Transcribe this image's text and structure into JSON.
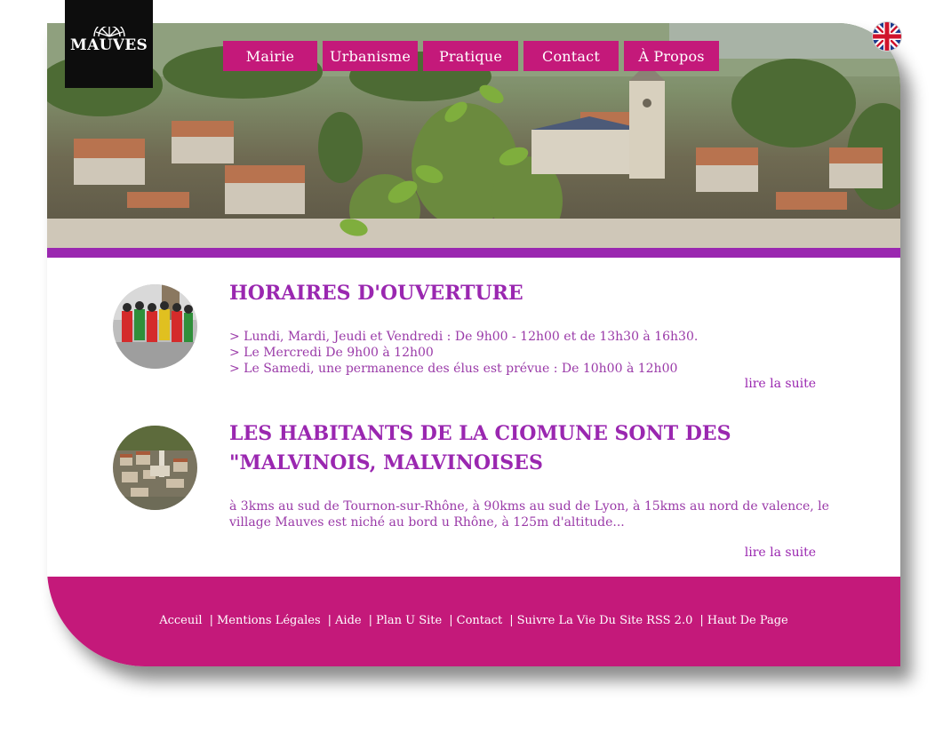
{
  "site": {
    "logo_text": "MAUVES",
    "language_flag": "uk-flag-icon"
  },
  "nav": {
    "items": [
      {
        "label": "Mairie"
      },
      {
        "label": "Urbanisme"
      },
      {
        "label": "Pratique"
      },
      {
        "label": "Contact"
      },
      {
        "label": "À Propos"
      }
    ]
  },
  "articles": [
    {
      "title": "HORAIRES D'OUVERTURE",
      "lines": [
        "> Lundi, Mardi, Jeudi et Vendredi : De 9h00 - 12h00 et de 13h30 à 16h30.",
        "> Le Mercredi De 9h00 à 12h00",
        "> Le Samedi, une permanence des élus est prévue : De 10h00 à 12h00"
      ],
      "more": "lire la suite"
    },
    {
      "title": "LES HABITANTS DE LA CIOMUNE SONT DES \"MALVINOIS, MALVINOISES",
      "text": "à 3kms au sud de Tournon-sur-Rhône, à 90kms au sud de Lyon, à 15kms au nord de valence, le village Mauves est niché au bord u Rhône, à 125m d'altitude...",
      "more": "lire la suite"
    }
  ],
  "footer": {
    "links": [
      "Acceuil",
      "Mentions Légales",
      "Aide",
      "Plan U Site",
      "Contact",
      "Suivre La Vie Du Site RSS 2.0",
      "Haut De Page"
    ]
  },
  "colors": {
    "magenta": "#c4197a",
    "purple": "#9a27b0"
  }
}
